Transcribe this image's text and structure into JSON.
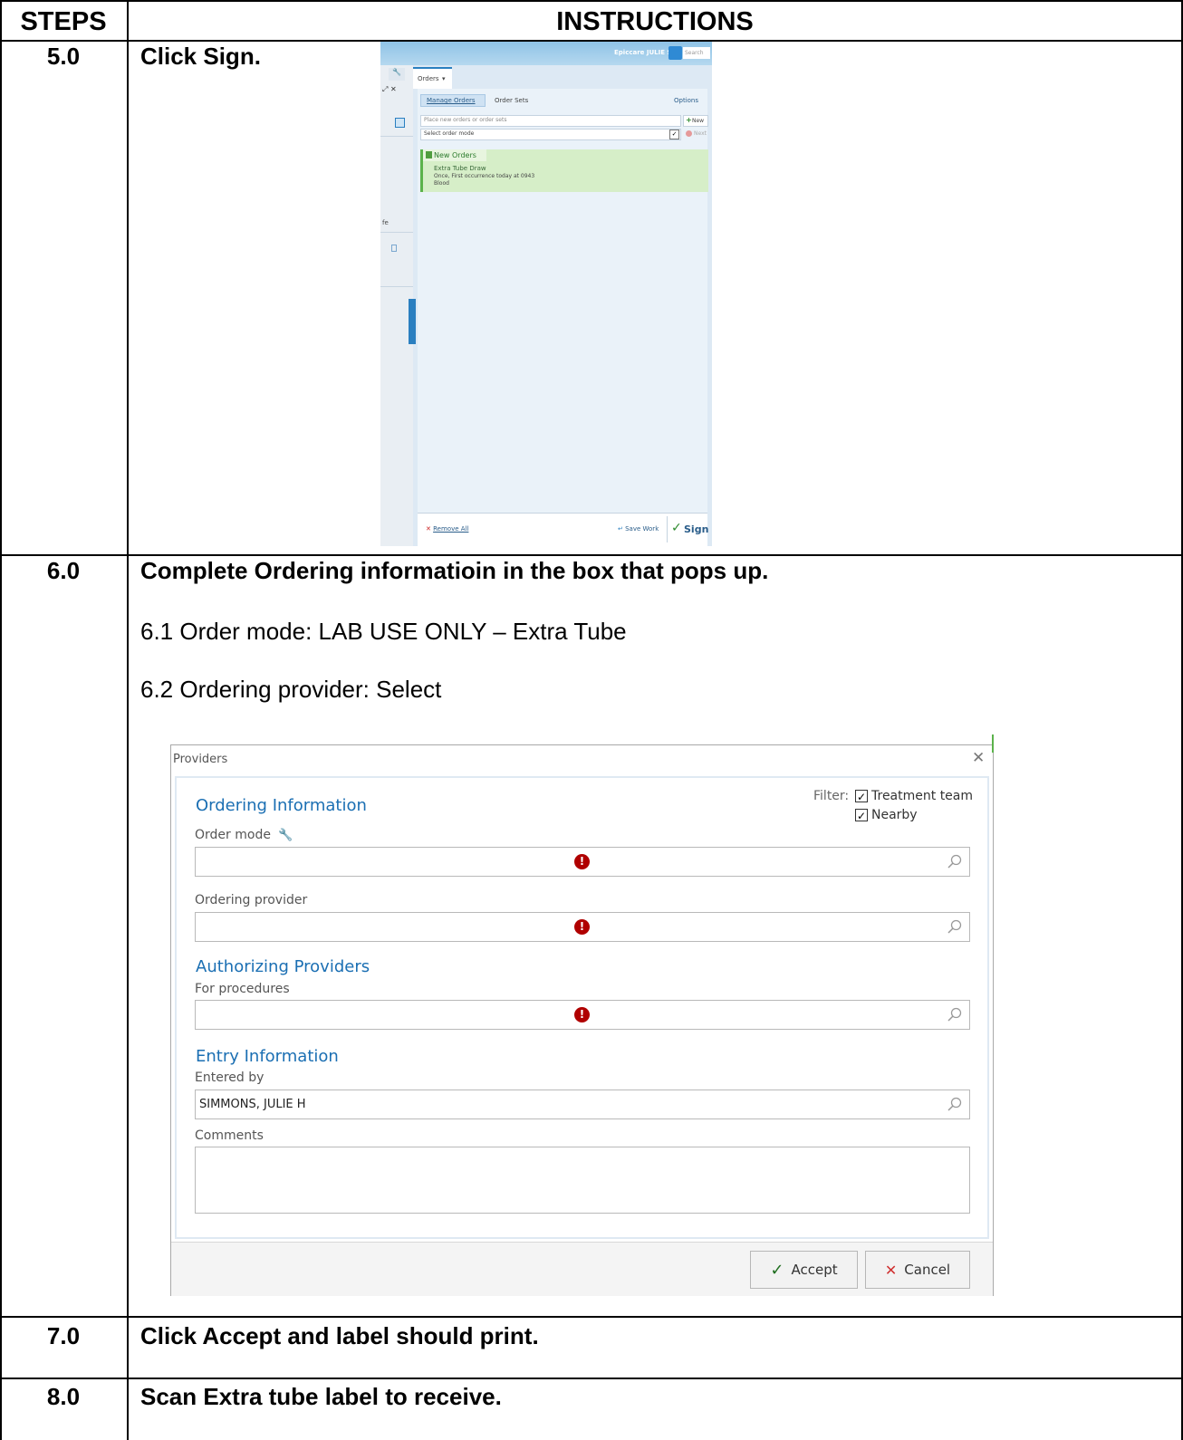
{
  "table": {
    "header_steps": "STEPS",
    "header_instructions": "INSTRUCTIONS"
  },
  "rows": [
    {
      "step": "5.0",
      "text": "Click Sign."
    },
    {
      "step": "6.0",
      "text": "Complete Ordering informatioin in the box that pops up.",
      "sub1": "6.1 Order mode:  LAB USE ONLY – Extra Tube",
      "sub2": "6.2 Ordering provider: Select"
    },
    {
      "step": "7.0",
      "text": "Click Accept and label should print."
    },
    {
      "step": "8.0",
      "text": "Scan Extra tube label to receive."
    }
  ],
  "epic": {
    "user": "Epiccare  JULIE S.",
    "search_placeholder": "Search",
    "orders_tab": "Orders",
    "manage_orders": "Manage Orders",
    "order_sets": "Order Sets",
    "options": "Options",
    "place_new_placeholder": "Place new orders or order sets",
    "new_button": "New",
    "select_order_mode": "Select order mode",
    "next_button": "Next",
    "new_orders_header": "New Orders",
    "order_name": "Extra Tube Draw",
    "order_detail": "Once, First occurrence today at 0943",
    "order_specimen": "Blood",
    "left_label": "fe",
    "remove_all": "Remove All",
    "save_work": "Save Work",
    "sign": "Sign"
  },
  "dialog": {
    "title": "Providers",
    "filter_label": "Filter:",
    "filter_treatment": "Treatment team",
    "filter_nearby": "Nearby",
    "ordering_info": "Ordering Information",
    "order_mode_label": "Order mode",
    "ordering_provider_label": "Ordering provider",
    "authorizing_providers": "Authorizing Providers",
    "for_procedures_label": "For procedures",
    "entry_information": "Entry Information",
    "entered_by_label": "Entered by",
    "entered_by_value": "SIMMONS, JULIE H",
    "comments_label": "Comments",
    "accept": "Accept",
    "cancel": "Cancel"
  }
}
